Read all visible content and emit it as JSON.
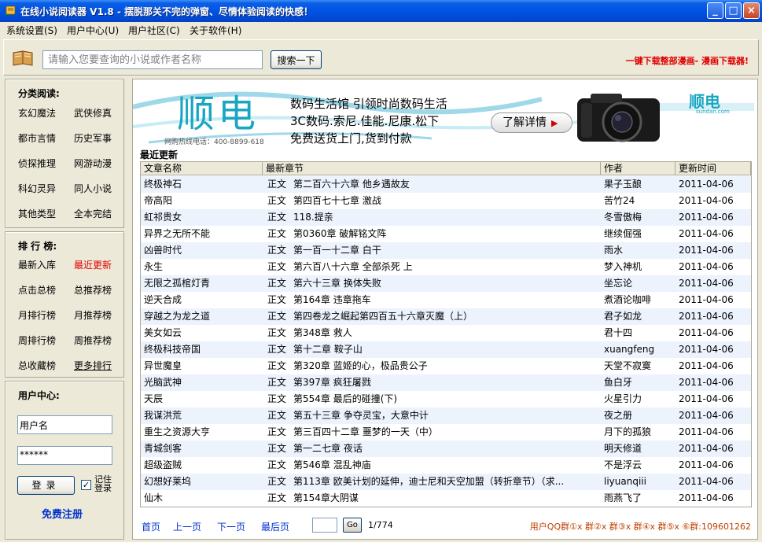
{
  "window": {
    "title": "在线小说阅读器 V1.8 - 摆脱那关不完的弹窗、尽情体验阅读的快感！",
    "min_symbol": "_",
    "max_symbol": "□",
    "close_symbol": "×"
  },
  "menu": [
    "系统设置(S)",
    "用户中心(U)",
    "用户社区(C)",
    "关于软件(H)"
  ],
  "search": {
    "placeholder": "请输入您要查询的小说或作者名称",
    "button": "搜索一下",
    "promo": "一键下载整部漫画- 漫画下载器!"
  },
  "categories": {
    "title": "分类阅读:",
    "items": [
      "玄幻魔法",
      "武侠修真",
      "都市言情",
      "历史军事",
      "侦探推理",
      "网游动漫",
      "科幻灵异",
      "同人小说",
      "其他类型",
      "全本完结"
    ]
  },
  "rankings": {
    "title": "排 行 榜:",
    "items": [
      "最新入库",
      "最近更新",
      "点击总榜",
      "总推荐榜",
      "月排行榜",
      "月推荐榜",
      "周排行榜",
      "周推荐榜",
      "总收藏榜",
      "更多排行"
    ]
  },
  "user": {
    "title": "用户中心:",
    "username": "用户名",
    "password": "******",
    "login": "登录",
    "check": "✓",
    "remember": "记住登录",
    "register": "免费注册"
  },
  "banner": {
    "brand": "顺电",
    "line1": "数码生活馆 引领时尚数码生活",
    "line2": "3C数码.索尼.佳能.尼康.松下",
    "line3": "免费送货上门,货到付款",
    "button": "了解详情",
    "hotline": "网购热线电话：400-8899-618",
    "small_brand": "顺电",
    "small_url": "sundan.com"
  },
  "section": "最近更新",
  "table": {
    "headers": [
      "文章名称",
      "最新章节",
      "作者",
      "更新时间"
    ],
    "rows": [
      {
        "name": "终极神石",
        "type": "正文",
        "chapter": "第二百六十六章 他乡遇故友",
        "author": "果子玉酿",
        "date": "2011-04-06"
      },
      {
        "name": "帝高阳",
        "type": "正文",
        "chapter": "第四百七十七章 激战",
        "author": "苦竹24",
        "date": "2011-04-06"
      },
      {
        "name": "虹祁贵女",
        "type": "正文",
        "chapter": "118.提亲",
        "author": "冬雪傲梅",
        "date": "2011-04-06"
      },
      {
        "name": "异界之无所不能",
        "type": "正文",
        "chapter": "第0360章 破解铭文阵",
        "author": "继续倔强",
        "date": "2011-04-06"
      },
      {
        "name": "凶兽时代",
        "type": "正文",
        "chapter": "第一百一十二章 白干",
        "author": "雨水",
        "date": "2011-04-06"
      },
      {
        "name": "永生",
        "type": "正文",
        "chapter": "第六百八十六章 全部杀死 上",
        "author": "梦入神机",
        "date": "2011-04-06"
      },
      {
        "name": "无限之孤棺灯青",
        "type": "正文",
        "chapter": "第六十三章 换体失败",
        "author": "坐忘论",
        "date": "2011-04-06"
      },
      {
        "name": "逆天合成",
        "type": "正文",
        "chapter": "第164章 违章拖车",
        "author": "煮酒论咖啡",
        "date": "2011-04-06"
      },
      {
        "name": "穿越之为龙之道",
        "type": "正文",
        "chapter": "第四卷龙之崛起第四百五十六章灭魔（上）",
        "author": "君子如龙",
        "date": "2011-04-06"
      },
      {
        "name": "美女如云",
        "type": "正文",
        "chapter": "第348章 救人",
        "author": "君十四",
        "date": "2011-04-06"
      },
      {
        "name": "终极科技帝国",
        "type": "正文",
        "chapter": "第十二章 鞍子山",
        "author": "xuangfeng",
        "date": "2011-04-06"
      },
      {
        "name": "异世魔皇",
        "type": "正文",
        "chapter": "第320章 蓝姬的心，极品贵公子",
        "author": "天堂不寂寞",
        "date": "2011-04-06"
      },
      {
        "name": "光脑武神",
        "type": "正文",
        "chapter": "第397章 疯狂屠戮",
        "author": "鱼白牙",
        "date": "2011-04-06"
      },
      {
        "name": "天辰",
        "type": "正文",
        "chapter": "第554章 最后的碰撞(下)",
        "author": "火星引力",
        "date": "2011-04-06"
      },
      {
        "name": "我谋洪荒",
        "type": "正文",
        "chapter": "第五十三章 争夺灵宝，大意中计",
        "author": "夜之册",
        "date": "2011-04-06"
      },
      {
        "name": "重生之资源大亨",
        "type": "正文",
        "chapter": "第三百四十二章 噩梦的一天（中）",
        "author": "月下的孤狼",
        "date": "2011-04-06"
      },
      {
        "name": "青城剑客",
        "type": "正文",
        "chapter": "第一二七章 夜话",
        "author": "明天修道",
        "date": "2011-04-06"
      },
      {
        "name": "超级盗贼",
        "type": "正文",
        "chapter": "第546章 混乱神庙",
        "author": "不是浮云",
        "date": "2011-04-06"
      },
      {
        "name": "幻想好莱坞",
        "type": "正文",
        "chapter": "第113章 欧美计划的延伸，迪士尼和天空加盟（转折章节）（求...",
        "author": "liyuanqiii",
        "date": "2011-04-06"
      },
      {
        "name": "仙木",
        "type": "正文",
        "chapter": "第154章大阴谋",
        "author": "雨燕飞了",
        "date": "2011-04-06"
      }
    ]
  },
  "pager": {
    "first": "首页",
    "prev": "上一页",
    "next": "下一页",
    "last": "最后页",
    "go": "Go",
    "count": "1/774",
    "qq": "用户QQ群①x 群②x 群③x 群④x 群⑤x ⑥群:109601262"
  },
  "colors": {
    "titlebar": "#0054e3",
    "link": "#0033cc",
    "highlight": "#e00000",
    "row_alt": "#ecf3fd"
  }
}
